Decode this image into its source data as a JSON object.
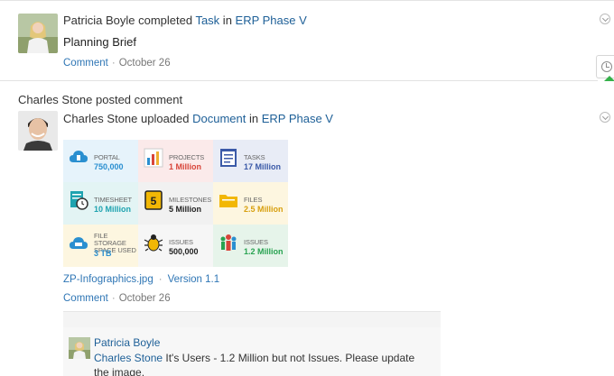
{
  "feed": [
    {
      "actor": "Patricia Boyle",
      "verb": " completed ",
      "object": "Task",
      "preposition": " in ",
      "project": "ERP Phase V",
      "body": "Planning Brief",
      "comment_label": "Comment",
      "date": "October 26"
    },
    {
      "post_title": "Charles Stone posted comment",
      "actor": "Charles Stone",
      "verb": " uploaded ",
      "object": "Document",
      "preposition": " in ",
      "project": "ERP Phase V",
      "file_name": "ZP-Infographics.jpg",
      "version": "Version 1.1",
      "comment_label": "Comment",
      "date": "October 26"
    }
  ],
  "infographic": [
    {
      "label": "PORTAL",
      "value": "750,000",
      "color": "#2a8fd0",
      "bg": "#e6f3fb",
      "icon": "cloud-icon"
    },
    {
      "label": "PROJECTS",
      "value": "1 Million",
      "color": "#d8453a",
      "bg": "#fbeaea",
      "icon": "bar-chart-icon"
    },
    {
      "label": "TASKS",
      "value": "17 Million",
      "color": "#3b5aa8",
      "bg": "#e8ecf6",
      "icon": "task-list-icon"
    },
    {
      "label": "TIMESHEET",
      "value": "10 Million",
      "color": "#1fa3b0",
      "bg": "#e3f4f4",
      "icon": "timesheet-icon"
    },
    {
      "label": "MILESTONES",
      "value": "5 Million",
      "color": "#222222",
      "bg": "#f1f1f1",
      "icon": "milestone-icon"
    },
    {
      "label": "FILES",
      "value": "2.5 Million",
      "color": "#d8a010",
      "bg": "#fdf6e0",
      "icon": "folder-icon"
    },
    {
      "label": "FILE STORAGE SPACE USED",
      "value": "3 TB",
      "color": "#2a8fd0",
      "bg": "#fdf6e0",
      "icon": "storage-cloud-icon"
    },
    {
      "label": "ISSUES",
      "value": "500,000",
      "color": "#222222",
      "bg": "#f6f6f6",
      "icon": "bug-icon"
    },
    {
      "label": "ISSUES",
      "value": "1.2 Million",
      "color": "#29a352",
      "bg": "#e6f4ea",
      "icon": "users-icon"
    }
  ],
  "reply": {
    "author": "Patricia Boyle",
    "mention": "Charles Stone",
    "text": " It's Users - 1.2 Million but not Issues. Please update the image."
  },
  "separator": "·"
}
